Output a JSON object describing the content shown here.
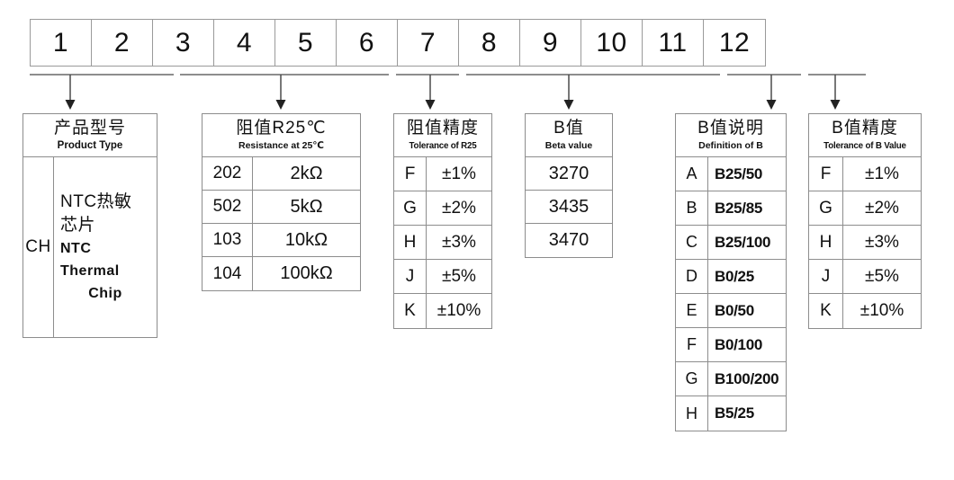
{
  "digits": [
    "1",
    "2",
    "3",
    "4",
    "5",
    "6",
    "7",
    "8",
    "9",
    "10",
    "11",
    "12"
  ],
  "groups": {
    "product_type": {
      "title_cn": "产品型号",
      "title_en": "Product Type",
      "code": "CH",
      "desc_cn_line1": "NTC热敏",
      "desc_cn_line2": "芯片",
      "desc_en_line1": "NTC Thermal",
      "desc_en_line2": "Chip"
    },
    "resistance": {
      "title_cn": "阻值R25℃",
      "title_en": "Resistance at 25℃",
      "rows": [
        {
          "code": "202",
          "value": "2kΩ"
        },
        {
          "code": "502",
          "value": "5kΩ"
        },
        {
          "code": "103",
          "value": "10kΩ"
        },
        {
          "code": "104",
          "value": "100kΩ"
        }
      ]
    },
    "tolerance_r25": {
      "title_cn": "阻值精度",
      "title_en": "Tolerance of R25",
      "rows": [
        {
          "code": "F",
          "value": "±1%"
        },
        {
          "code": "G",
          "value": "±2%"
        },
        {
          "code": "H",
          "value": "±3%"
        },
        {
          "code": "J",
          "value": "±5%"
        },
        {
          "code": "K",
          "value": "±10%"
        }
      ]
    },
    "beta_value": {
      "title_cn": "B值",
      "title_en": "Beta value",
      "rows": [
        {
          "value": "3270"
        },
        {
          "value": "3435"
        },
        {
          "value": "3470"
        }
      ]
    },
    "definition_b": {
      "title_cn": "B值说明",
      "title_en": "Definition  of B",
      "rows": [
        {
          "code": "A",
          "value": "B25/50"
        },
        {
          "code": "B",
          "value": "B25/85"
        },
        {
          "code": "C",
          "value": "B25/100"
        },
        {
          "code": "D",
          "value": "B0/25"
        },
        {
          "code": "E",
          "value": "B0/50"
        },
        {
          "code": "F",
          "value": "B0/100"
        },
        {
          "code": "G",
          "value": "B100/200"
        },
        {
          "code": "H",
          "value": "B5/25"
        }
      ]
    },
    "tolerance_b": {
      "title_cn": "B值精度",
      "title_en": "Tolerance of B Value",
      "rows": [
        {
          "code": "F",
          "value": "±1%"
        },
        {
          "code": "G",
          "value": "±2%"
        },
        {
          "code": "H",
          "value": "±3%"
        },
        {
          "code": "J",
          "value": "±5%"
        },
        {
          "code": "K",
          "value": "±10%"
        }
      ]
    }
  },
  "colors": {
    "line": "#8d8d8d",
    "text": "#111111",
    "background": "#ffffff"
  }
}
